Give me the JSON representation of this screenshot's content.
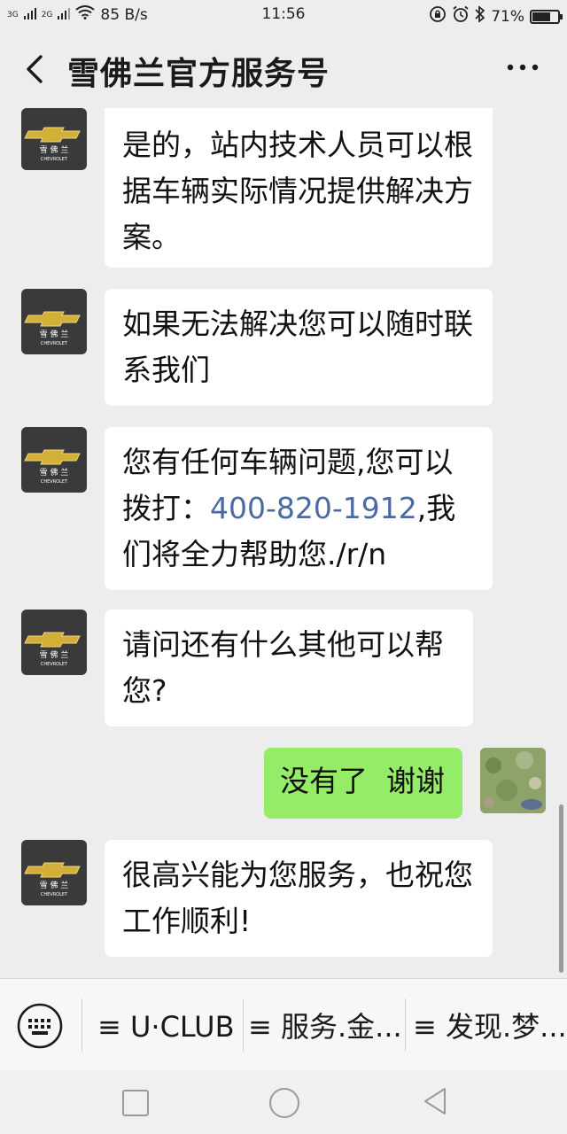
{
  "status": {
    "network_1": "3G",
    "network_2": "2G",
    "speed": "85 B/s",
    "time": "11:56",
    "battery_text": "71%",
    "battery_level": 0.71
  },
  "header": {
    "title": "雪佛兰官方服务号"
  },
  "messages": [
    {
      "from": "bot",
      "text": "是的，站内技术人员可以根据车辆实际情况提供解决方案。"
    },
    {
      "from": "bot",
      "text": "如果无法解决您可以随时联系我们"
    },
    {
      "from": "bot",
      "text_before": "您有任何车辆问题,您可以拨打：",
      "phone": "400-820-1912",
      "text_after": ",我们将全力帮助您./r/n"
    },
    {
      "from": "bot",
      "text": "请问还有什么其他可以帮您?"
    },
    {
      "from": "user",
      "text": "没有了  谢谢"
    },
    {
      "from": "bot",
      "text": "很高兴能为您服务，也祝您工作顺利!"
    }
  ],
  "menu": {
    "items": [
      {
        "label": "≡ U·CLUB"
      },
      {
        "label": "≡ 服务.金..."
      },
      {
        "label": "≡ 发现.梦..."
      }
    ]
  },
  "colors": {
    "bot_bubble": "#ffffff",
    "user_bubble": "#95ec69",
    "background": "#ededed",
    "phone_link": "#4b6aa3"
  }
}
